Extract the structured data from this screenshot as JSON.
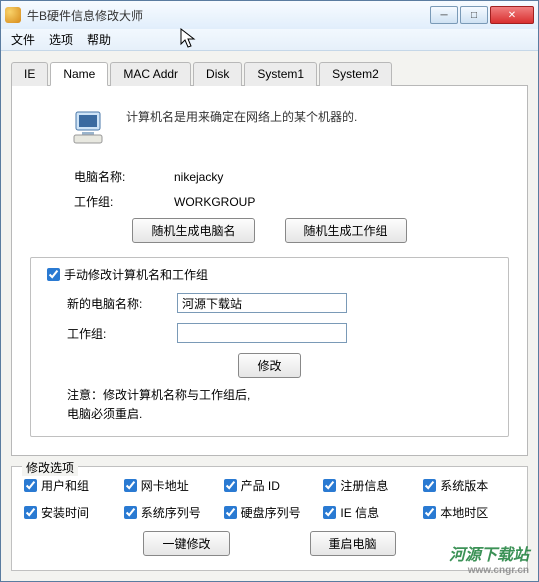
{
  "window": {
    "title": "牛B硬件信息修改大师"
  },
  "menu": {
    "file": "文件",
    "options": "选项",
    "help": "帮助"
  },
  "tabs": [
    "IE",
    "Name",
    "MAC Addr",
    "Disk",
    "System1",
    "System2"
  ],
  "active_tab": 1,
  "name_panel": {
    "description": "计算机名是用来确定在网络上的某个机器的.",
    "computer_name_label": "电脑名称:",
    "computer_name_value": "nikejacky",
    "workgroup_label": "工作组:",
    "workgroup_value": "WORKGROUP",
    "gen_name_btn": "随机生成电脑名",
    "gen_workgroup_btn": "随机生成工作组",
    "manual_checkbox_label": "手动修改计算机名和工作组",
    "manual_checked": true,
    "new_name_label": "新的电脑名称:",
    "new_name_value": "河源下载站",
    "new_workgroup_label": "工作组:",
    "new_workgroup_value": "",
    "modify_btn": "修改",
    "note": "注意：修改计算机名称与工作组后,\n电脑必须重启."
  },
  "mod_options": {
    "legend": "修改选项",
    "items": [
      {
        "label": "用户和组",
        "checked": true
      },
      {
        "label": "网卡地址",
        "checked": true
      },
      {
        "label": "产品 ID",
        "checked": true
      },
      {
        "label": "注册信息",
        "checked": true
      },
      {
        "label": "系统版本",
        "checked": true
      },
      {
        "label": "安装时间",
        "checked": true
      },
      {
        "label": "系统序列号",
        "checked": true
      },
      {
        "label": "硬盘序列号",
        "checked": true
      },
      {
        "label": "IE 信息",
        "checked": true
      },
      {
        "label": "本地时区",
        "checked": true
      }
    ],
    "onekey_btn": "一键修改",
    "restart_btn": "重启电脑"
  },
  "watermark": {
    "text": "河源下载站",
    "url": "www.cngr.cn"
  }
}
